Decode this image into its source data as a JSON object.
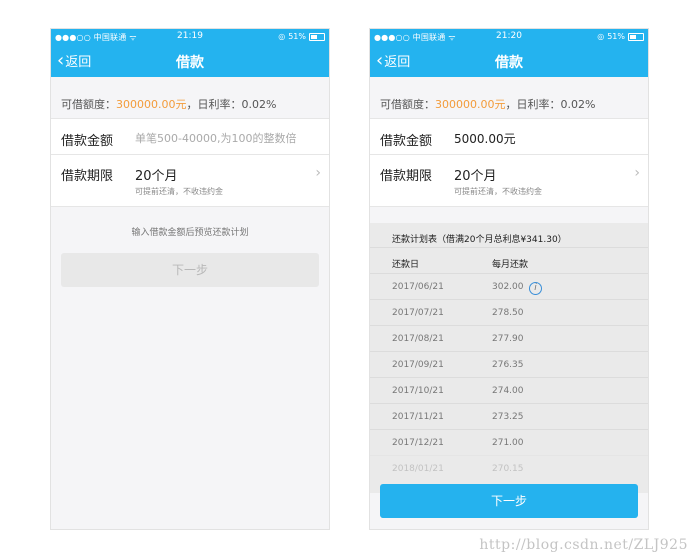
{
  "status": {
    "carrier": "●●●○○ 中国联通 ᯤ",
    "battery": "51%",
    "left_time": "21:19",
    "right_time": "21:20",
    "location_icon": "◎"
  },
  "nav": {
    "back_label": "返回",
    "back_icon": "‹",
    "title": "借款"
  },
  "quota": {
    "label": "可借额度：",
    "amount": "300000.00元",
    "rate_label": "，日利率：",
    "rate": "0.02%"
  },
  "amount_row": {
    "label": "借款金额",
    "placeholder": "单笔500-40000,为100的整数倍",
    "value": "5000.00元"
  },
  "term_row": {
    "label": "借款期限",
    "value": "20个月",
    "sub": "可提前还清，不收违约金",
    "arrow": "›"
  },
  "left": {
    "hint": "输入借款金额后预览还款计划",
    "next_label": "下一步"
  },
  "plan": {
    "title": "还款计划表（借满20个月总利息¥341.30）",
    "col_date": "还款日",
    "col_amount": "每月还款",
    "info_icon": "i",
    "rows": [
      {
        "date": "2017/06/21",
        "amount": "302.00"
      },
      {
        "date": "2017/07/21",
        "amount": "278.50"
      },
      {
        "date": "2017/08/21",
        "amount": "277.90"
      },
      {
        "date": "2017/09/21",
        "amount": "276.35"
      },
      {
        "date": "2017/10/21",
        "amount": "274.00"
      },
      {
        "date": "2017/11/21",
        "amount": "273.25"
      },
      {
        "date": "2017/12/21",
        "amount": "271.00"
      },
      {
        "date": "2018/01/21",
        "amount": "270.15"
      }
    ]
  },
  "right": {
    "next_label": "下一步"
  },
  "watermark": "http://blog.csdn.net/ZLJ925"
}
